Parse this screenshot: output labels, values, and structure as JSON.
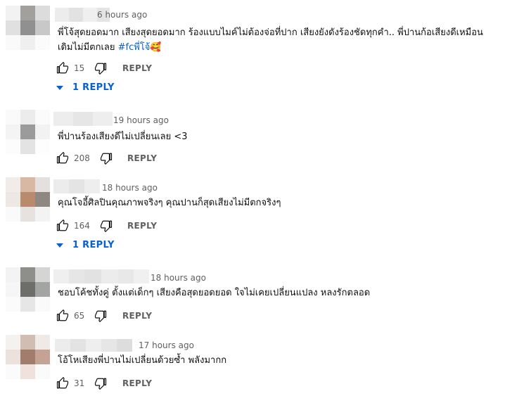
{
  "comments": [
    {
      "time": "6 hours ago",
      "text_lines": [
        "พี่โจ้สุดยอดมาก เสียงสุดยอดมาก ร้องแบบไมค์ไม่ต้องจ่อที่ปาก เสียงยังดังร้องชัดทุกคำ.. พี่ปานก้อเสียงดีเหมือน",
        "เดิมไม่มีตกเลย "
      ],
      "hashtag": "#fcพี่โจ้",
      "emoji": "🥰",
      "likes": "15",
      "reply_label": "REPLY",
      "replies_label": "1 REPLY"
    },
    {
      "time": "19 hours ago",
      "text_lines": [
        "พี่ปานร้องเสียงดีไม่เปลี่ยนเลย <3"
      ],
      "likes": "208",
      "reply_label": "REPLY"
    },
    {
      "time": "18 hours ago",
      "text_lines": [
        "คุณโจอี้ศิลปินคุณภาพจริงๆ คุณปานก็สุดเสียงไม่มีตกจริงๆ"
      ],
      "likes": "164",
      "reply_label": "REPLY",
      "replies_label": "1 REPLY"
    },
    {
      "time": "18 hours ago",
      "text_lines": [
        "ชอบโค้ชทั้งคู่ ตั้งแต่เด็กๆ เสียงคือสุดยอดยอด ใจไม่เคยเปลี่ยนแปลง หลงรักตลอด"
      ],
      "likes": "65",
      "reply_label": "REPLY"
    },
    {
      "time": "17 hours ago",
      "text_lines": [
        "โอ้โหเสียงพี่ปานไม่เปลี่ยนด้วยซ้ำ พลังมากก"
      ],
      "likes": "31",
      "reply_label": "REPLY"
    }
  ],
  "colors": {
    "link_blue": "#065fd4",
    "secondary_text": "#606060",
    "primary_text": "#0f0f0f"
  },
  "icons": {
    "like": "thumb-up-icon",
    "dislike": "thumb-down-icon",
    "expand": "caret-down-icon"
  }
}
